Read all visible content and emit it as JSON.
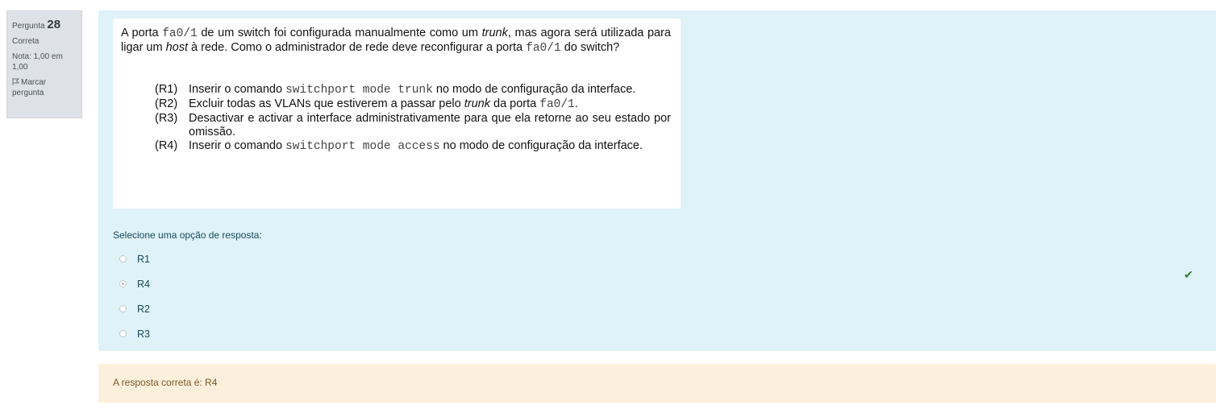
{
  "info": {
    "question_prefix": "Pergunta",
    "question_number": "28",
    "state": "Correta",
    "grade": "Nota: 1,00 em 1,00",
    "flag_label": "Marcar pergunta"
  },
  "question": {
    "intro": {
      "p1": "A porta ",
      "code1": "fa0/1",
      "p2": " de um switch foi configurada manualmente como um ",
      "em1": "trunk",
      "p3": ", mas agora será utilizada para ligar um ",
      "em2": "host",
      "p4": " à rede. Como o administrador de rede deve reconfigurar a porta ",
      "code2": "fa0/1",
      "p5": " do switch?"
    },
    "options": [
      {
        "label": "(R1)",
        "pre": "Inserir o comando ",
        "code": "switchport mode trunk",
        "post": " no modo de configuração da interface."
      },
      {
        "label": "(R2)",
        "pre": "Excluir todas as VLANs que estiverem a passar pelo ",
        "em": "trunk",
        "mid": " da porta ",
        "code": "fa0/1",
        "post": "."
      },
      {
        "label": "(R3)",
        "text": "Desactivar e activar a interface administrativamente para que ela retorne ao seu estado por omissão."
      },
      {
        "label": "(R4)",
        "pre": "Inserir o comando ",
        "code": "switchport mode access",
        "post": " no modo de configuração da interface."
      }
    ]
  },
  "prompt": "Selecione uma opção de resposta:",
  "answers": [
    {
      "label": "R1",
      "checked": false
    },
    {
      "label": "R4",
      "checked": true
    },
    {
      "label": "R2",
      "checked": false
    },
    {
      "label": "R3",
      "checked": false
    }
  ],
  "correct_mark_icon": "check-icon",
  "feedback": "A resposta correta é: R4",
  "colors": {
    "formulation_bg": "#def2f8",
    "outcome_bg": "#fcefdc",
    "info_bg": "#dee2e6",
    "correct": "#2e7d32"
  }
}
